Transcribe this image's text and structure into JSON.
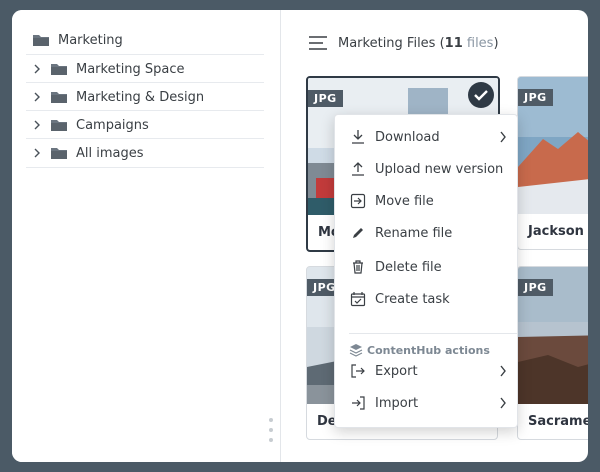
{
  "sidebar": {
    "root": {
      "label": "Marketing",
      "icon": "folder-icon"
    },
    "items": [
      {
        "label": "Marketing Space"
      },
      {
        "label": "Marketing & Design"
      },
      {
        "label": "Campaigns"
      },
      {
        "label": "All images"
      }
    ]
  },
  "header": {
    "title": "Marketing Files (",
    "count": "11",
    "count_suffix": " files",
    "close": ")"
  },
  "cards": [
    {
      "badge": "JPG",
      "name": "Mo",
      "selected": true
    },
    {
      "badge": "JPG",
      "name": "Jackson"
    },
    {
      "badge": "JPG",
      "name": "Del"
    },
    {
      "badge": "JPG",
      "name": "Sacramen"
    }
  ],
  "context_menu": {
    "items": [
      {
        "label": "Download",
        "icon": "download-icon",
        "submenu": true
      },
      {
        "label": "Upload new version",
        "icon": "upload-icon"
      },
      {
        "label": "Move file",
        "icon": "move-file-icon"
      },
      {
        "label": "Rename file",
        "icon": "pencil-icon"
      },
      {
        "label": "Delete file",
        "icon": "trash-icon"
      },
      {
        "label": "Create task",
        "icon": "calendar-check-icon"
      }
    ],
    "section_label": "ContentHub actions",
    "section_items": [
      {
        "label": "Export",
        "icon": "export-icon",
        "submenu": true
      },
      {
        "label": "Import",
        "icon": "import-icon",
        "submenu": true
      }
    ]
  },
  "colors": {
    "window_bg": "#4b5a66",
    "badge_bg": "#4f5b66",
    "selected_border": "#2f3a45",
    "muted_text": "#8a96a3"
  }
}
